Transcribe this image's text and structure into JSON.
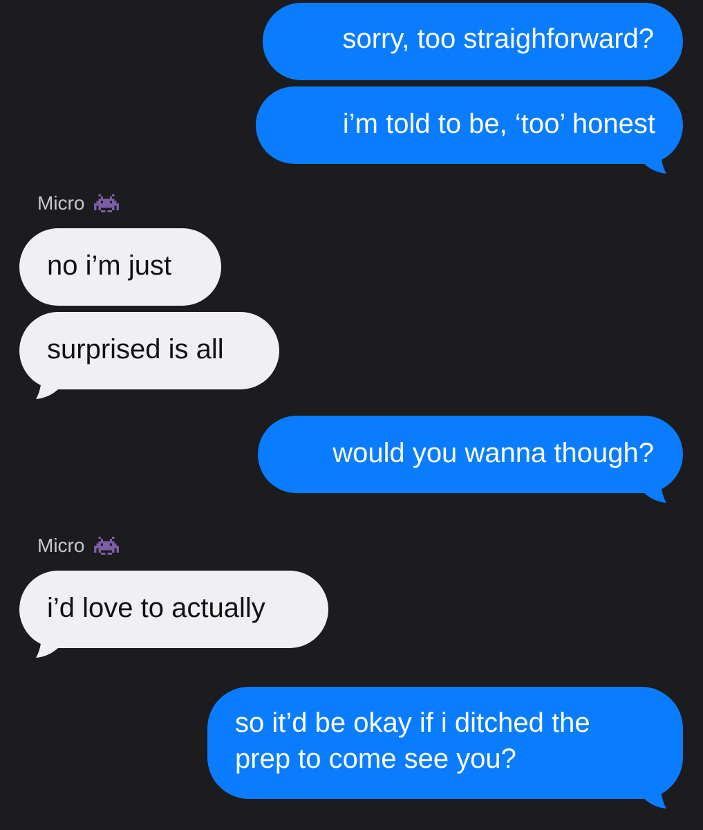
{
  "conversation": {
    "messages": [
      {
        "direction": "outgoing",
        "text": "sorry, too straighforward?"
      },
      {
        "direction": "outgoing",
        "text": "i’m told to be, ‘too’ honest"
      },
      {
        "direction": "incoming",
        "sender": "Micro",
        "sender_icon": "space-invader-emoji",
        "text": "no i’m just"
      },
      {
        "direction": "incoming",
        "text": "surprised is all"
      },
      {
        "direction": "outgoing",
        "text": "would you wanna though?"
      },
      {
        "direction": "incoming",
        "sender": "Micro",
        "sender_icon": "space-invader-emoji",
        "text": "i’d love to actually"
      },
      {
        "direction": "outgoing",
        "lines": [
          "so it’d be okay if i ditched the",
          "prep to come see you?"
        ]
      }
    ]
  },
  "colors": {
    "background": "#1c1c1e",
    "outgoing_bubble": "#0a7cff",
    "incoming_bubble": "#efeff4",
    "sender_label": "#c8c8cc",
    "emoji": "#7b5ea7"
  }
}
